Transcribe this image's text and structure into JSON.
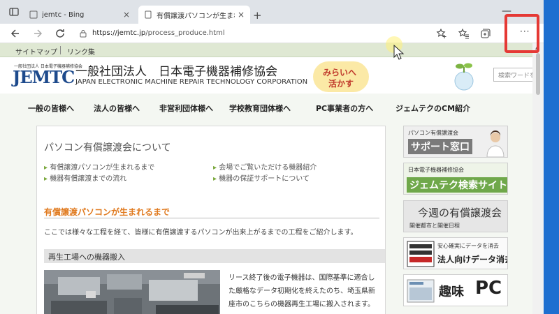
{
  "tabs": [
    {
      "label": "jemtc - Bing",
      "close": "×"
    },
    {
      "label": "有償譲渡パソコンが生まれるまで",
      "close": "×"
    }
  ],
  "new_tab": "+",
  "window_minimize": "—",
  "address": {
    "url_host": "https://jemtc.jp",
    "url_path": "/process_produce.html"
  },
  "more_menu": "···",
  "scroll_arrow": "▲",
  "top_links": [
    "サイトマップ",
    "リンク集"
  ],
  "header": {
    "logo_small": "一般社団法人 日本電子機器補修協会",
    "logo": "JEMTC",
    "org_name": "一般社団法人　日本電子機器補修協会",
    "org_en": "JAPAN ELECTRONIC MACHINE REPAIR TECHNOLOGY CORPORATION",
    "badge_line1": "みらいへ",
    "badge_line2": "活かす",
    "search_placeholder": "検索ワードを"
  },
  "menu": [
    "一般の皆様へ",
    "法人の皆様へ",
    "非営利団体様へ",
    "学校教育団体様へ",
    "PC事業者の方へ",
    "ジェムテクのCM紹介"
  ],
  "content": {
    "title": "パソコン有償譲渡会について",
    "links": [
      "有償譲渡パソコンが生まれるまで",
      "会場でご覧いただける機器紹介",
      "機器有償譲渡までの流れ",
      "機器の保証サポートについて"
    ],
    "subtitle": "有償譲渡パソコンが生まれるまで",
    "intro": "ここでは様々な工程を経て、皆様に有償譲渡するパソコンが出来上がるまでの工程をご紹介します。",
    "section": "再生工場への機器搬入",
    "para": "リース終了後の電子機器は、国際基準に適合した厳格なデータ初期化を終えたのち、埼玉県新座市のこちらの機器再生工場に搬入されます。"
  },
  "side": [
    {
      "small": "パソコン有償譲渡会",
      "big": "サポート窓口"
    },
    {
      "small": "日本電子機器補修協会",
      "big": "ジェムテク検索サイト"
    },
    {
      "big": "今週の有償譲渡会",
      "small": "開催都市と開催日程"
    },
    {
      "small": "安心確実にデータを消去",
      "big": "法人向けデータ消去"
    },
    {
      "big": "趣味",
      "pc": "PC"
    }
  ],
  "colors": {
    "accent_red": "#e53935",
    "logo_blue": "#1d4a8c",
    "orange_heading": "#e07a1f",
    "green_strip": "#dfe8d3"
  }
}
